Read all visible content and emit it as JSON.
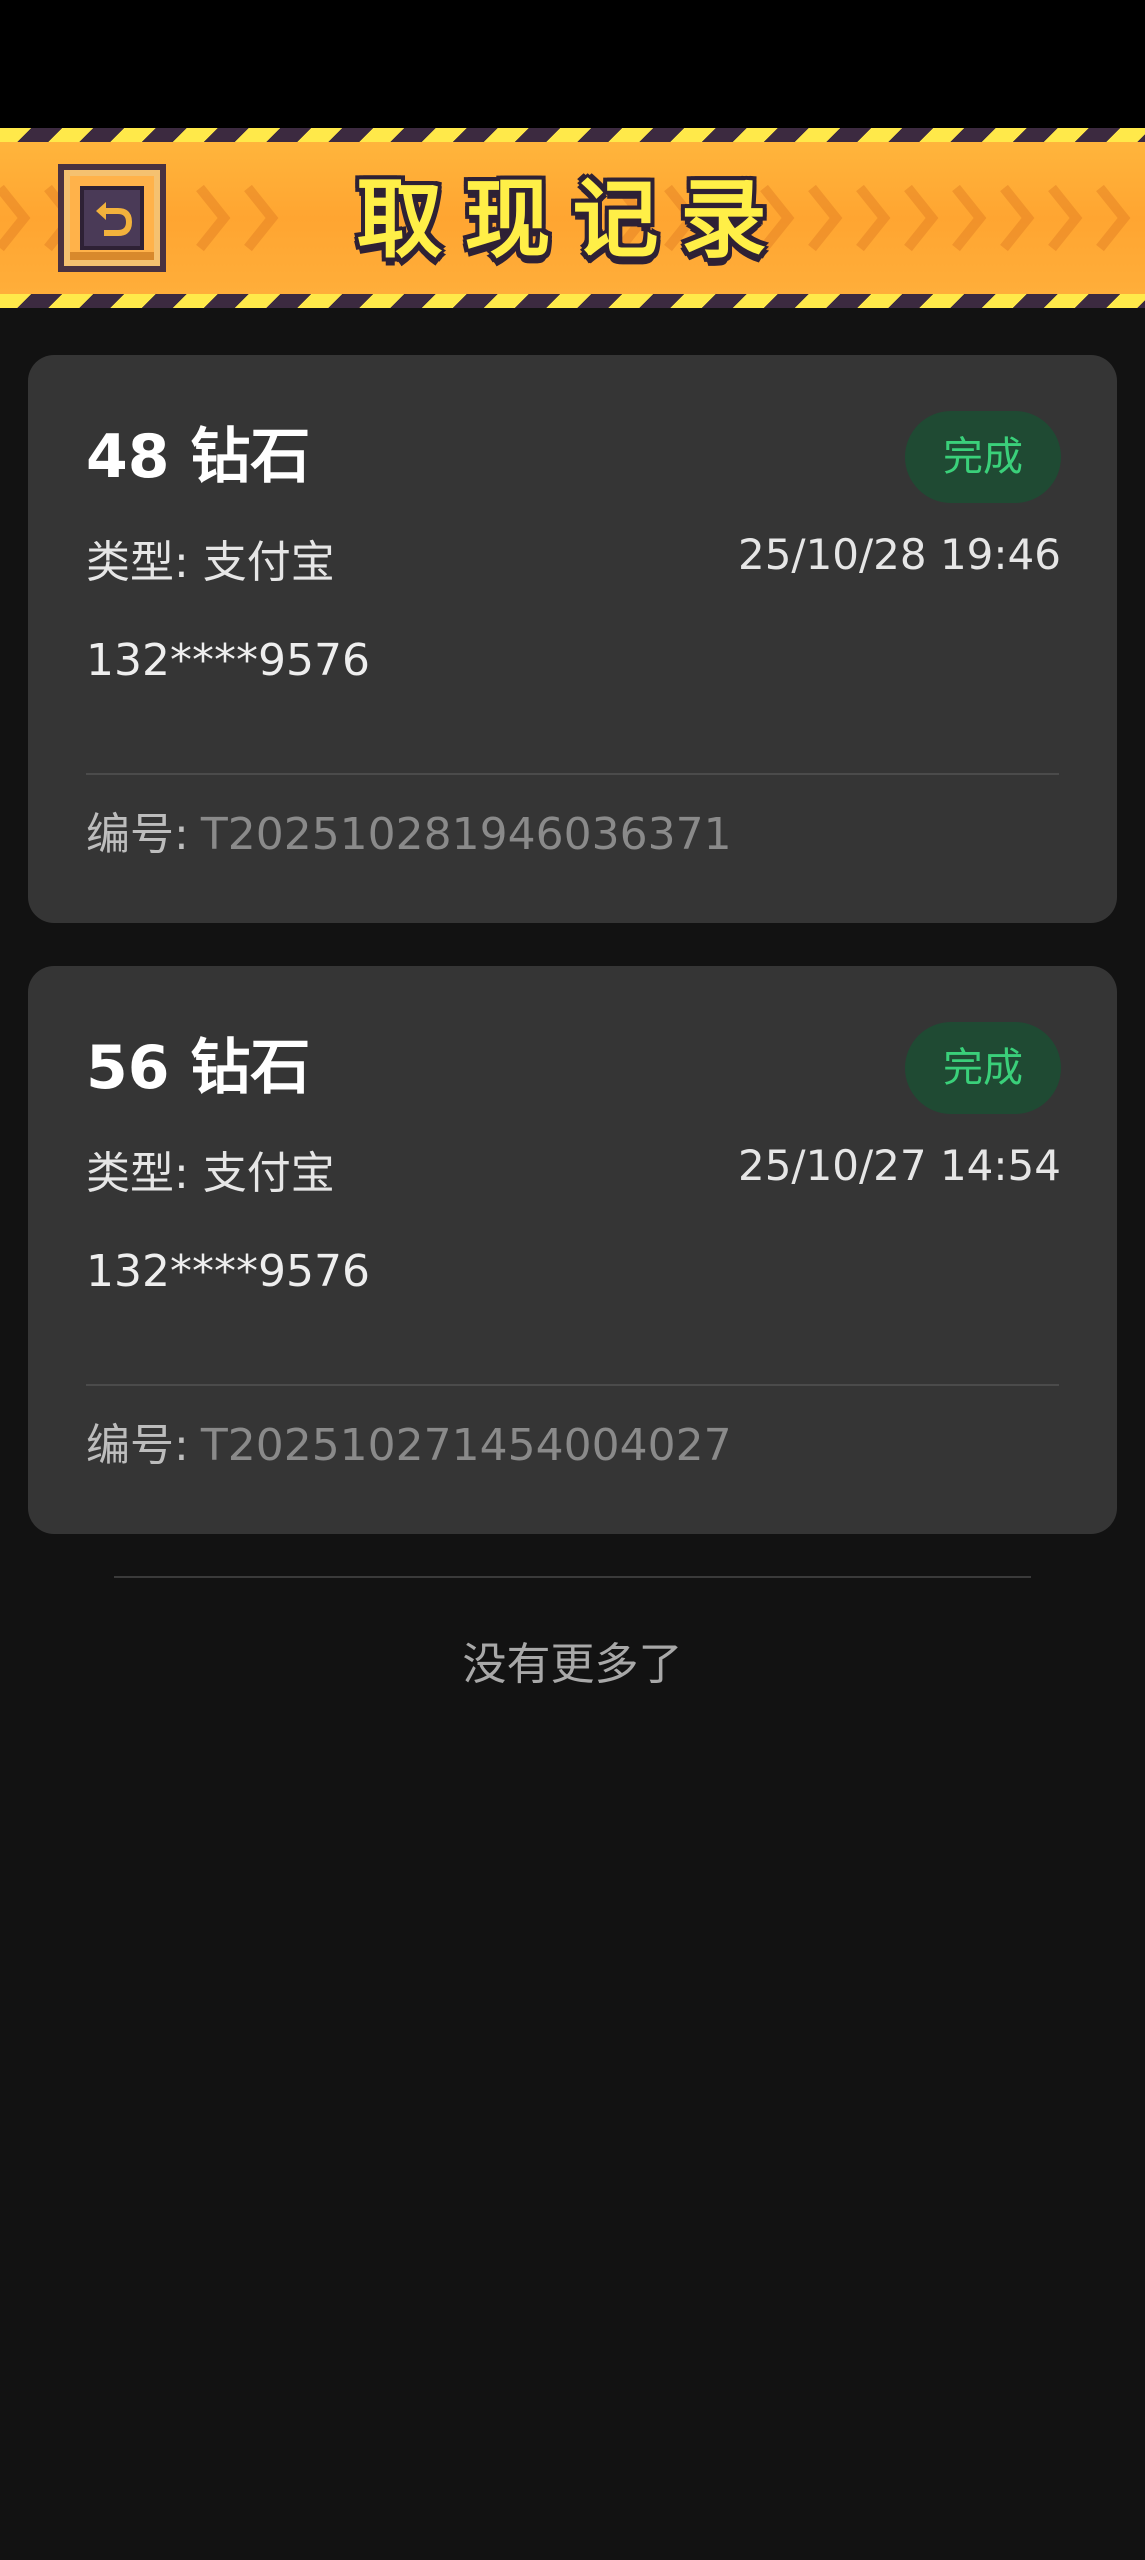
{
  "header": {
    "title": "取现记录",
    "back_icon": "back-arrow-icon"
  },
  "records": [
    {
      "amount": "48 钻石",
      "status": "完成",
      "type": "类型: 支付宝",
      "time": "25/10/28 19:46",
      "account": "132****9576",
      "order_label": "编号:",
      "order_no": "T202510281946036371"
    },
    {
      "amount": "56 钻石",
      "status": "完成",
      "type": "类型: 支付宝",
      "time": "25/10/27 14:54",
      "account": "132****9576",
      "order_label": "编号:",
      "order_no": "T202510271454004027"
    }
  ],
  "footer": {
    "end_text": "没有更多了"
  },
  "colors": {
    "background": "#121212",
    "card": "#353535",
    "status_green": "#3ad07a",
    "header_orange": "#ffa531",
    "title_yellow": "#ffef47"
  }
}
